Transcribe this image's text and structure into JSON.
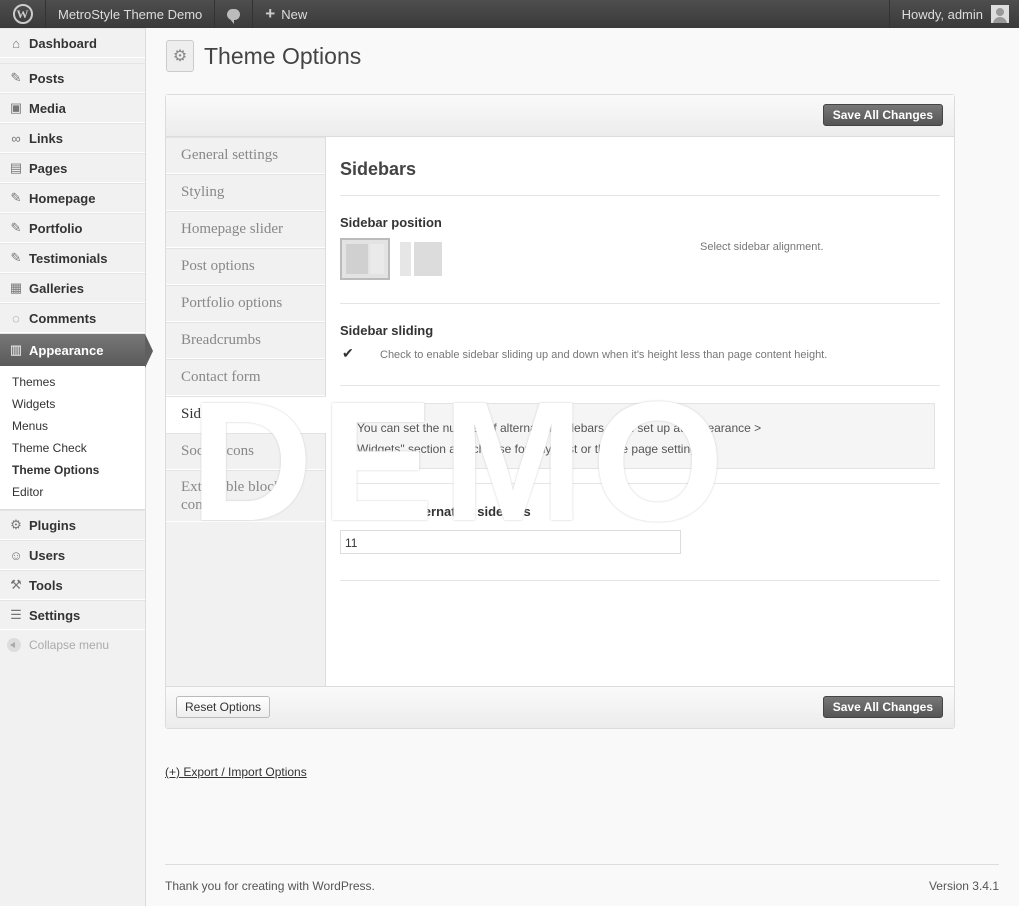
{
  "adminbar": {
    "site_name": "MetroStyle Theme Demo",
    "new_label": "New",
    "howdy": "Howdy, admin"
  },
  "menu": {
    "items": [
      {
        "label": "Dashboard",
        "icon": "house-icon"
      },
      {
        "label": "Posts",
        "icon": "pushpin-icon"
      },
      {
        "label": "Media",
        "icon": "media-icon"
      },
      {
        "label": "Links",
        "icon": "link-icon"
      },
      {
        "label": "Pages",
        "icon": "pages-icon"
      },
      {
        "label": "Homepage",
        "icon": "pushpin-icon"
      },
      {
        "label": "Portfolio",
        "icon": "pushpin-icon"
      },
      {
        "label": "Testimonials",
        "icon": "pushpin-icon"
      },
      {
        "label": "Galleries",
        "icon": "gallery-icon"
      },
      {
        "label": "Comments",
        "icon": "comment-icon"
      },
      {
        "label": "Appearance",
        "icon": "appearance-icon"
      },
      {
        "label": "Plugins",
        "icon": "plugin-icon"
      },
      {
        "label": "Users",
        "icon": "users-icon"
      },
      {
        "label": "Tools",
        "icon": "tools-icon"
      },
      {
        "label": "Settings",
        "icon": "settings-icon"
      }
    ],
    "submenu": [
      "Themes",
      "Widgets",
      "Menus",
      "Theme Check",
      "Theme Options",
      "Editor"
    ],
    "current_sub": "Theme Options",
    "collapse": "Collapse menu"
  },
  "page": {
    "title": "Theme Options",
    "save_label": "Save All Changes",
    "reset_label": "Reset Options",
    "export_label": "(+) Export / Import Options"
  },
  "tabs": [
    "General settings",
    "Styling",
    "Homepage slider",
    "Post options",
    "Portfolio options",
    "Breadcrumbs",
    "Contact form",
    "Sidebars",
    "Social icons",
    "Extensible blocks content"
  ],
  "active_tab": "Sidebars",
  "pane": {
    "heading": "Sidebars",
    "position_label": "Sidebar position",
    "position_desc": "Select sidebar alignment.",
    "sliding_label": "Sidebar sliding",
    "sliding_desc": "Check to enable sidebar sliding up and down when it's height less than page content height.",
    "sliding_checked": true,
    "info_line1": "You can set the number of alternative sidebars, then set up at Appearance >",
    "info_line2": "Widgets\" section and choose for any post or theme page settings.",
    "num_label": "Number of alternative sidebars",
    "num_value": "11"
  },
  "watermark": "DEMO",
  "footer": {
    "thanks": "Thank you for creating with WordPress.",
    "version": "Version 3.4.1"
  }
}
